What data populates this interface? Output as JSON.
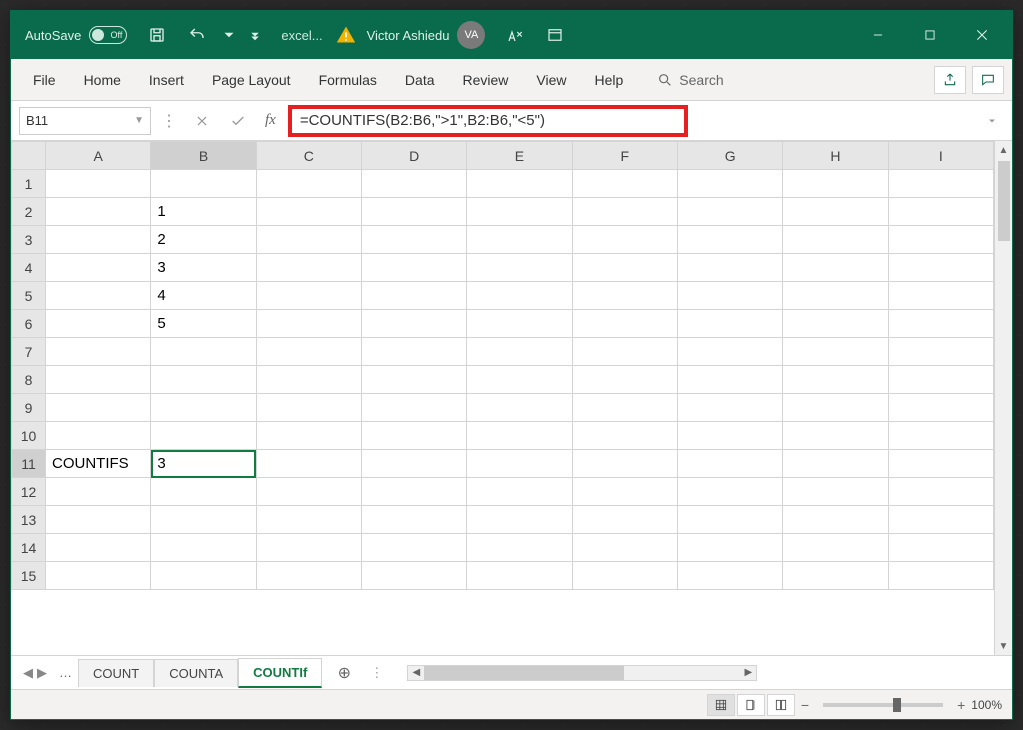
{
  "titlebar": {
    "autosave_label": "AutoSave",
    "autosave_state": "Off",
    "filename": "excel...",
    "username": "Victor Ashiedu",
    "user_initials": "VA"
  },
  "ribbon": {
    "file": "File",
    "tabs": [
      "Home",
      "Insert",
      "Page Layout",
      "Formulas",
      "Data",
      "Review",
      "View",
      "Help"
    ],
    "search": "Search"
  },
  "formula_bar": {
    "name_box": "B11",
    "fx": "fx",
    "formula": "=COUNTIFS(B2:B6,\">1\",B2:B6,\"<5\")"
  },
  "columns": [
    "A",
    "B",
    "C",
    "D",
    "E",
    "F",
    "G",
    "H",
    "I"
  ],
  "rows": [
    {
      "n": 1,
      "A": "",
      "B": ""
    },
    {
      "n": 2,
      "A": "",
      "B": "1"
    },
    {
      "n": 3,
      "A": "",
      "B": "2"
    },
    {
      "n": 4,
      "A": "",
      "B": "3"
    },
    {
      "n": 5,
      "A": "",
      "B": "4"
    },
    {
      "n": 6,
      "A": "",
      "B": "5"
    },
    {
      "n": 7,
      "A": "",
      "B": ""
    },
    {
      "n": 8,
      "A": "",
      "B": ""
    },
    {
      "n": 9,
      "A": "",
      "B": ""
    },
    {
      "n": 10,
      "A": "",
      "B": ""
    },
    {
      "n": 11,
      "A": "COUNTIFS",
      "B": "3"
    },
    {
      "n": 12,
      "A": "",
      "B": ""
    },
    {
      "n": 13,
      "A": "",
      "B": ""
    },
    {
      "n": 14,
      "A": "",
      "B": ""
    },
    {
      "n": 15,
      "A": "",
      "B": ""
    }
  ],
  "sheet_tabs": {
    "tabs": [
      "COUNT",
      "COUNTA",
      "COUNTIf"
    ],
    "active": "COUNTIf"
  },
  "statusbar": {
    "zoom": "100%"
  }
}
